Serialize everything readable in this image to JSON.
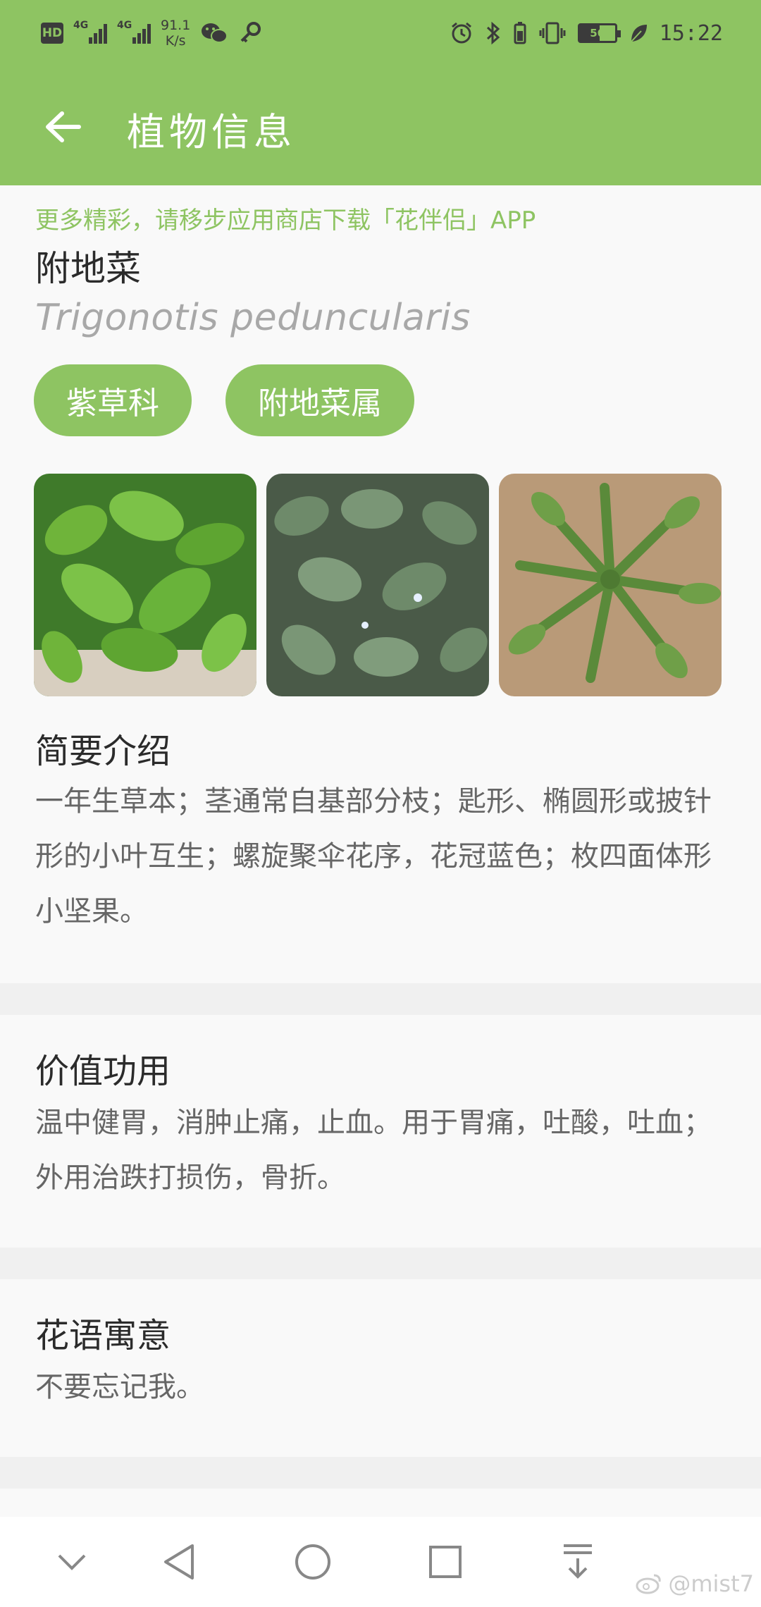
{
  "status_bar": {
    "hd": "HD",
    "net1": "4G",
    "net2": "4G",
    "speed_value": "91.1",
    "speed_unit": "K/s",
    "battery": "56",
    "time": "15:22"
  },
  "app_bar": {
    "title": "植物信息",
    "back_icon": "arrow-left-icon"
  },
  "plant": {
    "promo": "更多精彩，请移步应用商店下载「花伴侣」APP",
    "chinese_name": "附地菜",
    "latin_name": "Trigonotis peduncularis",
    "family": "紫草科",
    "genus": "附地菜属"
  },
  "sections": {
    "intro": {
      "title": "简要介绍",
      "body": "一年生草本；茎通常自基部分枝；匙形、椭圆形或披针形的小叶互生；螺旋聚伞花序，花冠蓝色；枚四面体形小坚果。"
    },
    "value": {
      "title": "价值功用",
      "body": "温中健胃，消肿止痛，止血。用于胃痛，吐酸，吐血；外用治跌打损伤，骨折。"
    },
    "flower_language": {
      "title": "花语寓意",
      "body": "不要忘记我。"
    }
  },
  "colors": {
    "accent": "#8ec462",
    "card": "#f9f9f9",
    "separator": "#f0f0f0"
  },
  "watermark": "@mist7"
}
